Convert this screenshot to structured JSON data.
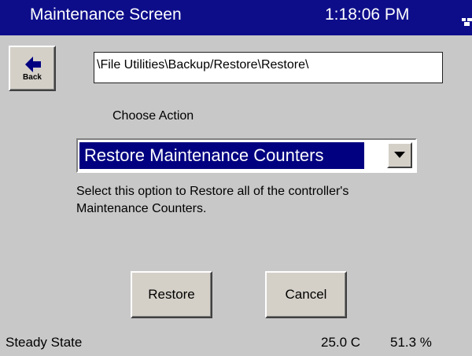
{
  "window": {
    "title": "Maintenance Screen",
    "time": "1:18:06 PM",
    "tray_icon": "network-tray-icon"
  },
  "nav": {
    "back_label": "Back",
    "back_icon": "left-arrow-icon"
  },
  "path": {
    "value": "\\File Utilities\\Backup/Restore\\Restore\\"
  },
  "action": {
    "label": "Choose Action",
    "selected": "Restore Maintenance Counters",
    "description": "Select this option to Restore all of the controller's Maintenance Counters."
  },
  "buttons": {
    "restore_label": "Restore",
    "cancel_label": "Cancel"
  },
  "status": {
    "state": "Steady State",
    "temperature": "25.0 C",
    "humidity": "51.3 %"
  },
  "colors": {
    "titlebar": "#0d0d8a",
    "background": "#c8c8c8",
    "selection": "#000080"
  }
}
